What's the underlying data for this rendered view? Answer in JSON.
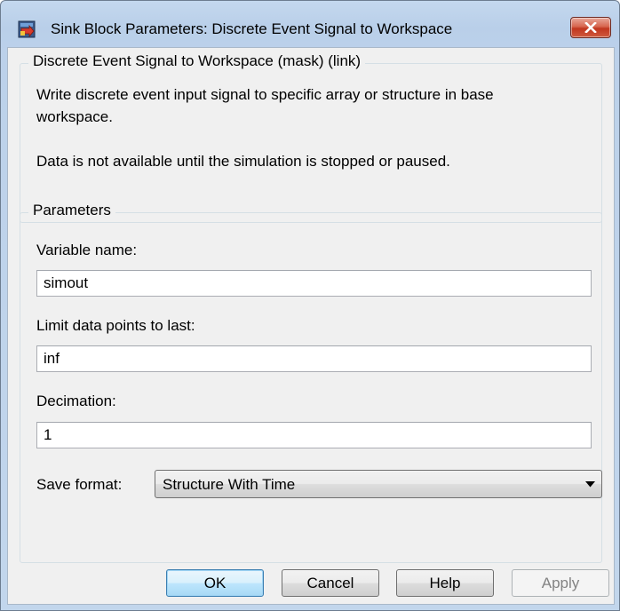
{
  "window": {
    "title": "Sink Block Parameters: Discrete Event Signal to Workspace",
    "icon": "simulink-block-icon",
    "close_icon": "close-icon"
  },
  "description": {
    "legend": "Discrete Event Signal to Workspace (mask) (link)",
    "line1": "Write discrete event input signal to specific array or structure in base",
    "line2": "workspace.",
    "note": "Data is not available until the simulation is stopped or paused."
  },
  "parameters": {
    "legend": "Parameters",
    "variable_name": {
      "label": "Variable name:",
      "value": "simout"
    },
    "limit_data_points": {
      "label": "Limit data points to last:",
      "value": "inf"
    },
    "decimation": {
      "label": "Decimation:",
      "value": "1"
    },
    "save_format": {
      "label": "Save format:",
      "value": "Structure With Time",
      "arrow_icon": "dropdown-arrow-icon"
    }
  },
  "buttons": {
    "ok": "OK",
    "cancel": "Cancel",
    "help": "Help",
    "apply": "Apply"
  },
  "colors": {
    "titlebar": "#bcd1ea",
    "client_bg": "#f0f0f0",
    "close_button": "#c9452b",
    "ok_button_border": "#3c7fb1",
    "disabled_text": "#838383"
  }
}
